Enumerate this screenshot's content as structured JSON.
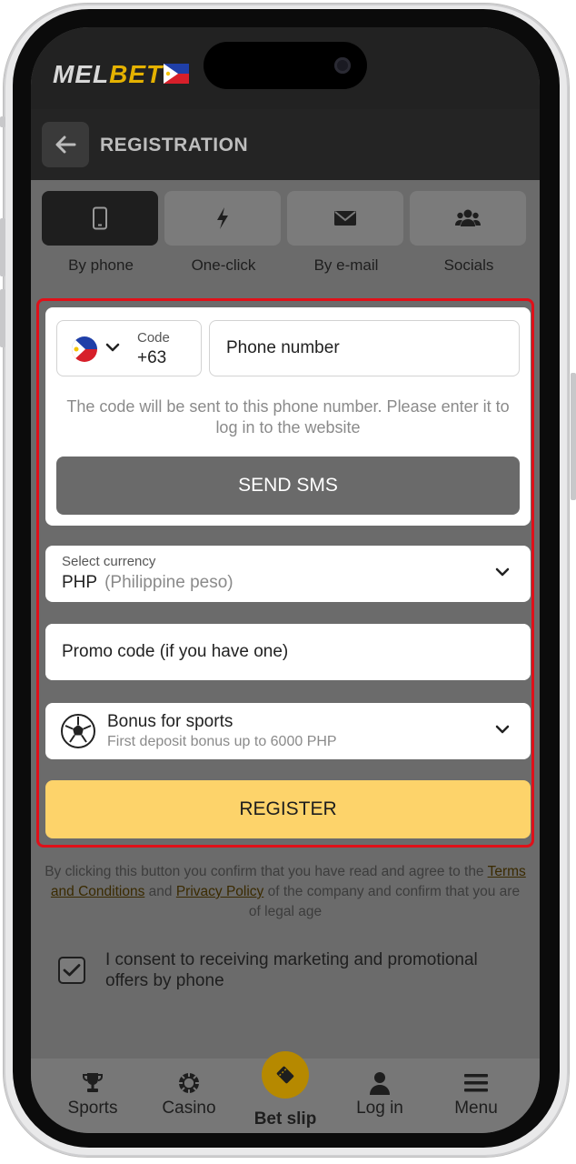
{
  "app": {
    "logo_part1": "MEL",
    "logo_part2": "BET",
    "page_title": "REGISTRATION"
  },
  "tabs": [
    {
      "label": "By phone",
      "icon": "smartphone-icon",
      "active": true
    },
    {
      "label": "One-click",
      "icon": "lightning-icon",
      "active": false
    },
    {
      "label": "By e-mail",
      "icon": "envelope-icon",
      "active": false
    },
    {
      "label": "Socials",
      "icon": "users-icon",
      "active": false
    }
  ],
  "phone": {
    "code_label": "Code",
    "code_value": "+63",
    "placeholder": "Phone number",
    "hint": "The code will be sent to this phone number. Please enter it to log in to the website",
    "send_label": "SEND SMS"
  },
  "currency": {
    "label": "Select currency",
    "code": "PHP",
    "name": "(Philippine peso)"
  },
  "promo": {
    "placeholder": "Promo code (if you have one)"
  },
  "bonus": {
    "title": "Bonus for sports",
    "subtitle": "First deposit bonus up to 6000 PHP"
  },
  "register_label": "REGISTER",
  "terms": {
    "prefix": "By clicking this button you confirm that you have read and agree to the",
    "terms_link": "Terms and Conditions",
    "and": "and",
    "privacy_link": "Privacy Policy",
    "suffix": "of the company and confirm that you are of legal age"
  },
  "consent": {
    "text": "I consent to receiving marketing and promotional offers by phone",
    "checked": true
  },
  "nav": {
    "sports": "Sports",
    "casino": "Casino",
    "betslip": "Bet slip",
    "login": "Log in",
    "menu": "Menu"
  },
  "colors": {
    "accent_yellow": "#fdd36a",
    "highlight_red": "#e01019",
    "brand_gold": "#e5b200"
  }
}
